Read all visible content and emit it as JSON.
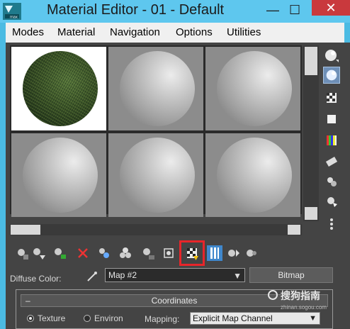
{
  "window": {
    "title": "Material Editor - 01 - Default",
    "app_icon": "3dsmax-app-icon",
    "minimize_label": "—",
    "maximize_label": "☐",
    "close_label": "✕"
  },
  "menu": {
    "items": [
      "Modes",
      "Material",
      "Navigation",
      "Options",
      "Utilities"
    ]
  },
  "sample_slots": [
    {
      "material": "grass-texture-sphere",
      "active": true
    },
    {
      "material": "default-gray-sphere",
      "active": false
    },
    {
      "material": "default-gray-sphere",
      "active": false
    },
    {
      "material": "default-gray-sphere",
      "active": false
    },
    {
      "material": "default-gray-sphere",
      "active": false
    },
    {
      "material": "default-gray-sphere",
      "active": false
    }
  ],
  "side_toolbar": {
    "icons": [
      "sample-type-sphere-icon",
      "backlight-icon",
      "background-checker-icon",
      "sample-uv-tiling-icon",
      "video-color-check-icon",
      "make-preview-icon",
      "options-icon",
      "select-by-material-icon",
      "material-map-navigator-icon"
    ]
  },
  "main_toolbar": {
    "icons": [
      "get-material-icon",
      "put-to-scene-icon",
      "assign-to-selection-icon",
      "reset-map-icon",
      "make-unique-icon",
      "put-to-library-icon",
      "material-id-channel-icon",
      "show-shaded-material-icon",
      "show-map-in-viewport-icon",
      "show-end-result-icon",
      "go-to-parent-icon",
      "go-forward-to-sibling-icon"
    ],
    "highlighted_index": 7
  },
  "diffuse": {
    "label": "Diffuse Color:",
    "map_value": "Map #2",
    "map_type_button": "Bitmap"
  },
  "coordinates": {
    "collapse_symbol": "–",
    "title": "Coordinates",
    "options": [
      {
        "label": "Texture",
        "selected": true
      },
      {
        "label": "Environ",
        "selected": false
      }
    ],
    "mapping_label": "Mapping:",
    "mapping_value": "Explicit Map Channel"
  },
  "watermark": {
    "main": "搜狗指南",
    "sub": "zhinan.sogou.com"
  },
  "colors": {
    "title_bar": "#5ec7ee",
    "panel_bg": "#444444",
    "highlight_red": "#e8252a",
    "close_red": "#c9393d"
  }
}
